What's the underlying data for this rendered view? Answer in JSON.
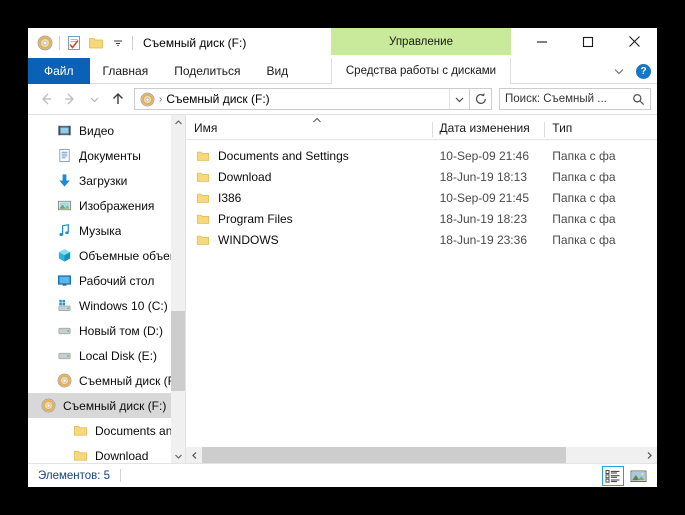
{
  "window": {
    "title": "Съемный диск (F:)",
    "quick_access": [
      {
        "name": "disc-drive-icon",
        "label": "Съемный диск"
      },
      {
        "name": "properties-icon",
        "label": "Свойства"
      },
      {
        "name": "new-folder-icon",
        "label": "Новая папка"
      },
      {
        "name": "qat-dropdown-icon",
        "label": "Настроить панель быстрого доступа"
      }
    ],
    "controls": {
      "minimize": "—",
      "maximize": "□",
      "close": "✕"
    }
  },
  "ribbon": {
    "tabs": [
      {
        "label": "Файл",
        "active_style": "file"
      },
      {
        "label": "Главная",
        "active_style": "normal"
      },
      {
        "label": "Поделиться",
        "active_style": "normal"
      },
      {
        "label": "Вид",
        "active_style": "normal"
      }
    ],
    "contextual": {
      "group_label": "Управление",
      "tab_label": "Средства работы с дисками",
      "group_color": "#c9ea9b"
    },
    "collapse_label": "Свернуть ленту",
    "help_label": "?"
  },
  "address": {
    "back_label": "Назад",
    "forward_label": "Вперед",
    "recent_label": "Последние расположения",
    "up_label": "Вверх",
    "crumb_icon": "disc-drive-icon",
    "crumb_sep": "›",
    "path": "Съемный диск (F:)",
    "dropdown_label": "Предыдущие расположения",
    "refresh_label": "Обновить"
  },
  "search": {
    "placeholder": "Поиск: Съемный ...",
    "icon": "search-icon"
  },
  "sidebar": {
    "items": [
      {
        "label": "Видео",
        "icon": "video-icon",
        "indent": 1,
        "selected": false
      },
      {
        "label": "Документы",
        "icon": "documents-icon",
        "indent": 1,
        "selected": false
      },
      {
        "label": "Загрузки",
        "icon": "downloads-icon",
        "indent": 1,
        "selected": false
      },
      {
        "label": "Изображения",
        "icon": "pictures-icon",
        "indent": 1,
        "selected": false
      },
      {
        "label": "Музыка",
        "icon": "music-icon",
        "indent": 1,
        "selected": false
      },
      {
        "label": "Объемные объекты",
        "icon": "3d-objects-icon",
        "indent": 1,
        "selected": false
      },
      {
        "label": "Рабочий стол",
        "icon": "desktop-icon",
        "indent": 1,
        "selected": false
      },
      {
        "label": "Windows 10 (C:)",
        "icon": "windows-drive-icon",
        "indent": 1,
        "selected": false
      },
      {
        "label": "Новый том (D:)",
        "icon": "drive-icon",
        "indent": 1,
        "selected": false
      },
      {
        "label": "Local Disk (E:)",
        "icon": "drive-icon",
        "indent": 1,
        "selected": false
      },
      {
        "label": "Съемный диск (F:)",
        "icon": "disc-drive-icon",
        "indent": 1,
        "selected": false
      },
      {
        "label": "Съемный диск (F:)",
        "icon": "disc-drive-icon",
        "indent": 0,
        "selected": true
      },
      {
        "label": "Documents and Settings",
        "icon": "folder-icon",
        "indent": 1,
        "selected": false
      },
      {
        "label": "Download",
        "icon": "folder-icon",
        "indent": 1,
        "selected": false
      }
    ]
  },
  "file_list": {
    "columns": [
      {
        "key": "name",
        "label": "Имя",
        "sorted": true,
        "sort_dir": "asc"
      },
      {
        "key": "date",
        "label": "Дата изменения",
        "sorted": false
      },
      {
        "key": "type",
        "label": "Тип",
        "sorted": false
      }
    ],
    "rows": [
      {
        "name": "Documents and Settings",
        "date": "10-Sep-09 21:46",
        "type": "Папка с фа",
        "icon": "folder-icon"
      },
      {
        "name": "Download",
        "date": "18-Jun-19 18:13",
        "type": "Папка с фа",
        "icon": "folder-icon"
      },
      {
        "name": "I386",
        "date": "10-Sep-09 21:45",
        "type": "Папка с фа",
        "icon": "folder-icon"
      },
      {
        "name": "Program Files",
        "date": "18-Jun-19 18:23",
        "type": "Папка с фа",
        "icon": "folder-icon"
      },
      {
        "name": "WINDOWS",
        "date": "18-Jun-19 23:36",
        "type": "Папка с фа",
        "icon": "folder-icon"
      }
    ]
  },
  "status": {
    "item_count_text": "Элементов: 5",
    "view_buttons": [
      {
        "name": "details-view-button",
        "label": "Таблица",
        "active": true
      },
      {
        "name": "thumbnails-view-button",
        "label": "Крупные значки",
        "active": false
      }
    ]
  }
}
